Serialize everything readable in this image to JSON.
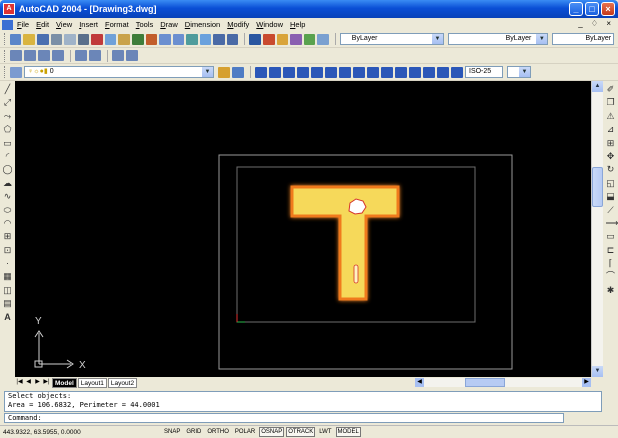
{
  "window": {
    "title": "AutoCAD 2004 - [Drawing3.dwg]",
    "app_icon": "autocad-icon",
    "controls": [
      "_",
      "□",
      "×"
    ],
    "doc_controls": "_ ♢ ×"
  },
  "menubar": {
    "items": [
      "File",
      "Edit",
      "View",
      "Insert",
      "Format",
      "Tools",
      "Draw",
      "Dimension",
      "Modify",
      "Window",
      "Help"
    ]
  },
  "properties": {
    "layer_value": "0",
    "color_value": "ByLayer",
    "linetype_value": "ByLayer",
    "lineweight_value": "ByLayer",
    "dimstyle_value": "ISO-25"
  },
  "layout_tabs": {
    "nav": [
      "|◀",
      "◀",
      "▶",
      "▶|"
    ],
    "tabs": [
      "Model",
      "Layout1",
      "Layout2"
    ],
    "active": "Model"
  },
  "canvas": {
    "ucs_x_label": "X",
    "ucs_y_label": "Y",
    "colors": {
      "background": "#000000",
      "shape_fill": "#f6d95a",
      "shape_glow": "#f07a1a",
      "frame": "#9a9a9a"
    }
  },
  "command": {
    "history": [
      "Select objects:",
      "Area = 106.6832, Perimeter = 44.0001"
    ],
    "prompt": "Command:"
  },
  "status": {
    "coordinates": "443.9322, 63.5955, 0.0000",
    "toggles": [
      {
        "label": "SNAP",
        "on": false
      },
      {
        "label": "GRID",
        "on": false
      },
      {
        "label": "ORTHO",
        "on": false
      },
      {
        "label": "POLAR",
        "on": false
      },
      {
        "label": "OSNAP",
        "on": true
      },
      {
        "label": "OTRACK",
        "on": true
      },
      {
        "label": "LWT",
        "on": false
      },
      {
        "label": "MODEL",
        "on": true
      }
    ]
  }
}
